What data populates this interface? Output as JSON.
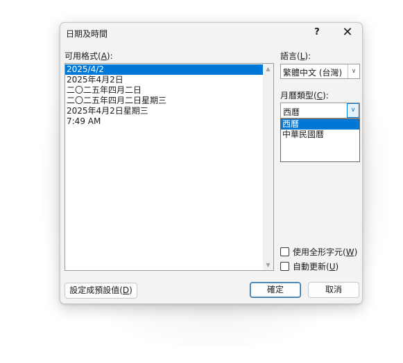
{
  "dialog": {
    "title": "日期及時間",
    "help_label": "?",
    "close_label": "✕"
  },
  "formats": {
    "label_prefix": "可用格式(",
    "label_key": "A",
    "label_suffix": "):",
    "items": [
      "2025/4/2",
      "2025年4月2日",
      "二〇二五年四月二日",
      "二〇二五年四月二日星期三",
      "2025年4月2日星期三",
      "7:49 AM"
    ],
    "selected_index": 0
  },
  "language": {
    "label_prefix": "語言(",
    "label_key": "L",
    "label_suffix": "):",
    "value": "繁體中文 (台灣)"
  },
  "calendar": {
    "label_prefix": "月曆類型(",
    "label_key": "C",
    "label_suffix": "):",
    "value": "西曆",
    "options": [
      "西曆",
      "中華民國曆"
    ],
    "selected_index": 0
  },
  "checkboxes": {
    "full_width_prefix": "使用全形字元(",
    "full_width_key": "W",
    "full_width_suffix": ")",
    "full_width_checked": false,
    "auto_update_prefix": "自動更新(",
    "auto_update_key": "U",
    "auto_update_suffix": ")",
    "auto_update_checked": false
  },
  "buttons": {
    "set_default_prefix": "設定成預設值(",
    "set_default_key": "D",
    "set_default_suffix": ")",
    "ok": "確定",
    "cancel": "取消"
  },
  "icons": {
    "scroll_up": "▲",
    "scroll_down": "▼",
    "chevron_down": "∨"
  }
}
